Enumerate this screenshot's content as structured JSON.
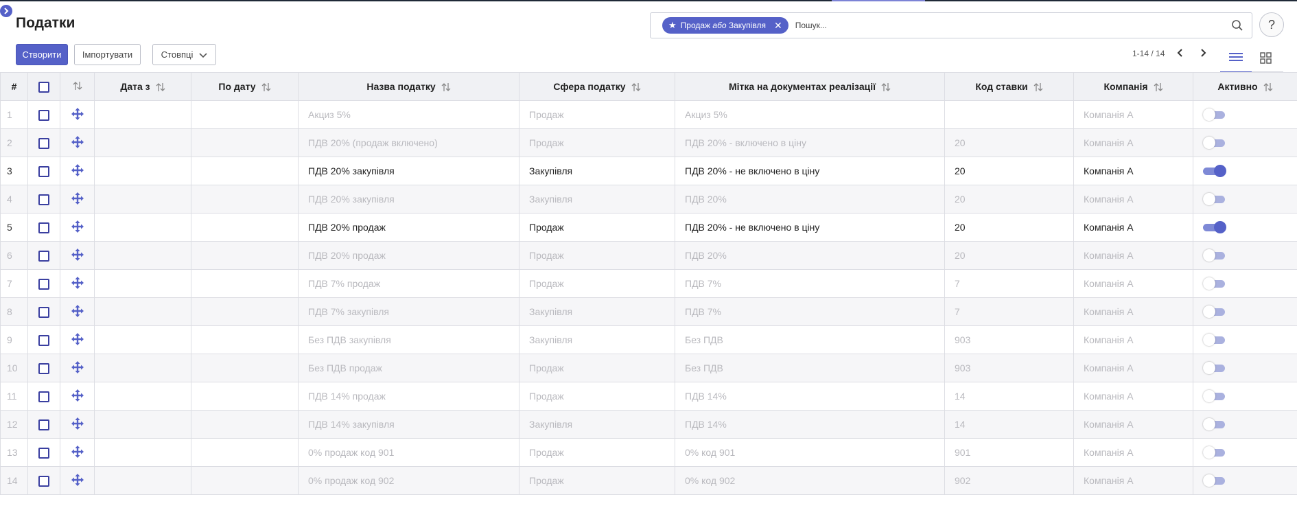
{
  "page": {
    "title": "Податки"
  },
  "search": {
    "facet_icon": "star-icon",
    "facet_left": "Продаж",
    "facet_or": "або",
    "facet_right": "Закупівля",
    "placeholder": "Пошук..."
  },
  "help": {
    "label": "?"
  },
  "toolbar": {
    "create_label": "Створити",
    "import_label": "Імпортувати",
    "columns_label": "Стовпці"
  },
  "pager": {
    "text": "1-14 / 14"
  },
  "colors": {
    "accent": "#5561c8",
    "inactive_text": "#b9b9be"
  },
  "table": {
    "headers": {
      "num": "#",
      "date_from": "Дата з",
      "date_to": "По дату",
      "name": "Назва податку",
      "scope": "Сфера податку",
      "label": "Мітка на документах реалізації",
      "code": "Код ставки",
      "company": "Компанія",
      "active": "Активно"
    },
    "rows": [
      {
        "n": "1",
        "name": "Акциз 5%",
        "scope": "Продаж",
        "label": "Акциз 5%",
        "code": "",
        "company": "Компанія А",
        "active": false
      },
      {
        "n": "2",
        "name": "ПДВ 20% (продаж включено)",
        "scope": "Продаж",
        "label": "ПДВ 20% - включено в ціну",
        "code": "20",
        "company": "Компанія А",
        "active": false
      },
      {
        "n": "3",
        "name": "ПДВ 20% закупівля",
        "scope": "Закупівля",
        "label": "ПДВ 20% - не включено в ціну",
        "code": "20",
        "company": "Компанія А",
        "active": true
      },
      {
        "n": "4",
        "name": "ПДВ 20% закупівля",
        "scope": "Закупівля",
        "label": "ПДВ 20%",
        "code": "20",
        "company": "Компанія А",
        "active": false
      },
      {
        "n": "5",
        "name": "ПДВ 20% продаж",
        "scope": "Продаж",
        "label": "ПДВ 20% - не включено в ціну",
        "code": "20",
        "company": "Компанія А",
        "active": true
      },
      {
        "n": "6",
        "name": "ПДВ 20% продаж",
        "scope": "Продаж",
        "label": "ПДВ 20%",
        "code": "20",
        "company": "Компанія А",
        "active": false
      },
      {
        "n": "7",
        "name": "ПДВ 7% продаж",
        "scope": "Продаж",
        "label": "ПДВ 7%",
        "code": "7",
        "company": "Компанія А",
        "active": false
      },
      {
        "n": "8",
        "name": "ПДВ 7% закупівля",
        "scope": "Закупівля",
        "label": "ПДВ 7%",
        "code": "7",
        "company": "Компанія А",
        "active": false
      },
      {
        "n": "9",
        "name": "Без ПДВ закупівля",
        "scope": "Закупівля",
        "label": "Без ПДВ",
        "code": "903",
        "company": "Компанія А",
        "active": false
      },
      {
        "n": "10",
        "name": "Без ПДВ продаж",
        "scope": "Продаж",
        "label": "Без ПДВ",
        "code": "903",
        "company": "Компанія А",
        "active": false
      },
      {
        "n": "11",
        "name": "ПДВ 14% продаж",
        "scope": "Продаж",
        "label": "ПДВ 14%",
        "code": "14",
        "company": "Компанія А",
        "active": false
      },
      {
        "n": "12",
        "name": "ПДВ 14% закупівля",
        "scope": "Закупівля",
        "label": "ПДВ 14%",
        "code": "14",
        "company": "Компанія А",
        "active": false
      },
      {
        "n": "13",
        "name": "0% продаж код 901",
        "scope": "Продаж",
        "label": "0% код 901",
        "code": "901",
        "company": "Компанія А",
        "active": false
      },
      {
        "n": "14",
        "name": "0% продаж код 902",
        "scope": "Продаж",
        "label": "0% код 902",
        "code": "902",
        "company": "Компанія А",
        "active": false
      }
    ]
  }
}
